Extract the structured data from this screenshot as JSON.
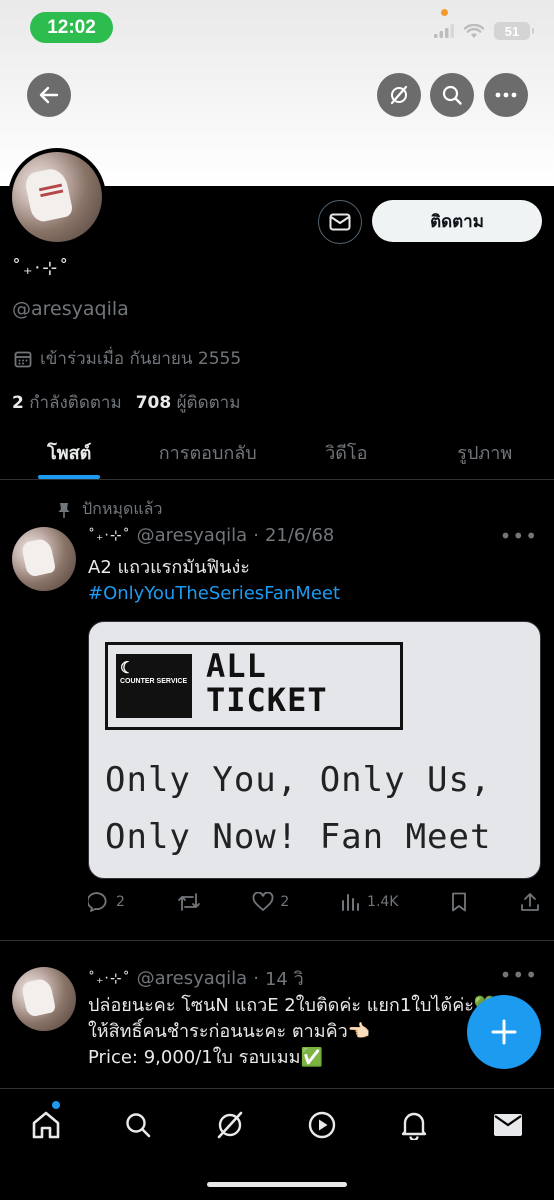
{
  "status_bar": {
    "time": "12:02",
    "battery": "51"
  },
  "profile": {
    "display_name": "˚₊‧⊹˚",
    "handle": "@aresyaqila",
    "joined": "เข้าร่วมเมื่อ กันยายน 2555",
    "following_count": "2",
    "following_label": "กำลังติดตาม",
    "followers_count": "708",
    "followers_label": "ผู้ติดตาม",
    "follow_button": "ติดตาม"
  },
  "tabs": [
    {
      "label": "โพสต์",
      "active": true
    },
    {
      "label": "การตอบกลับ",
      "active": false
    },
    {
      "label": "วิดีโอ",
      "active": false
    },
    {
      "label": "รูปภาพ",
      "active": false
    }
  ],
  "posts": [
    {
      "pinned_label": "ปักหมุดแล้ว",
      "name": "˚₊‧⊹˚",
      "handle": "@aresyaqila",
      "time": "21/6/68",
      "text_line1": "A2 แถวแรกมันฟินง่ะ",
      "hashtag": "#OnlyYouTheSeriesFanMeet",
      "media": {
        "logo_small": "COUNTER SERVICE",
        "logo_line1": "ALL",
        "logo_line2": "TICKET",
        "line1": "Only You, Only Us,",
        "line2": "Only Now! Fan Meet"
      },
      "replies": "2",
      "likes": "2",
      "views": "1.4K"
    },
    {
      "name": "˚₊‧⊹˚",
      "handle": "@aresyaqila",
      "time": "14 วิ",
      "line1": "ปล่อยนะคะ โซนN แถวE 2ใบติดค่ะ แยก1ใบได้ค่ะ💚",
      "line2": "ให้สิทธิ์คนชำระก่อนนะคะ ตามคิว👈🏻",
      "line3": "Price: 9,000/1ใบ รอบเมม✅"
    }
  ],
  "colors": {
    "accent": "#1d9bf0",
    "muted": "#71767b",
    "status_green": "#2dbd4e"
  }
}
